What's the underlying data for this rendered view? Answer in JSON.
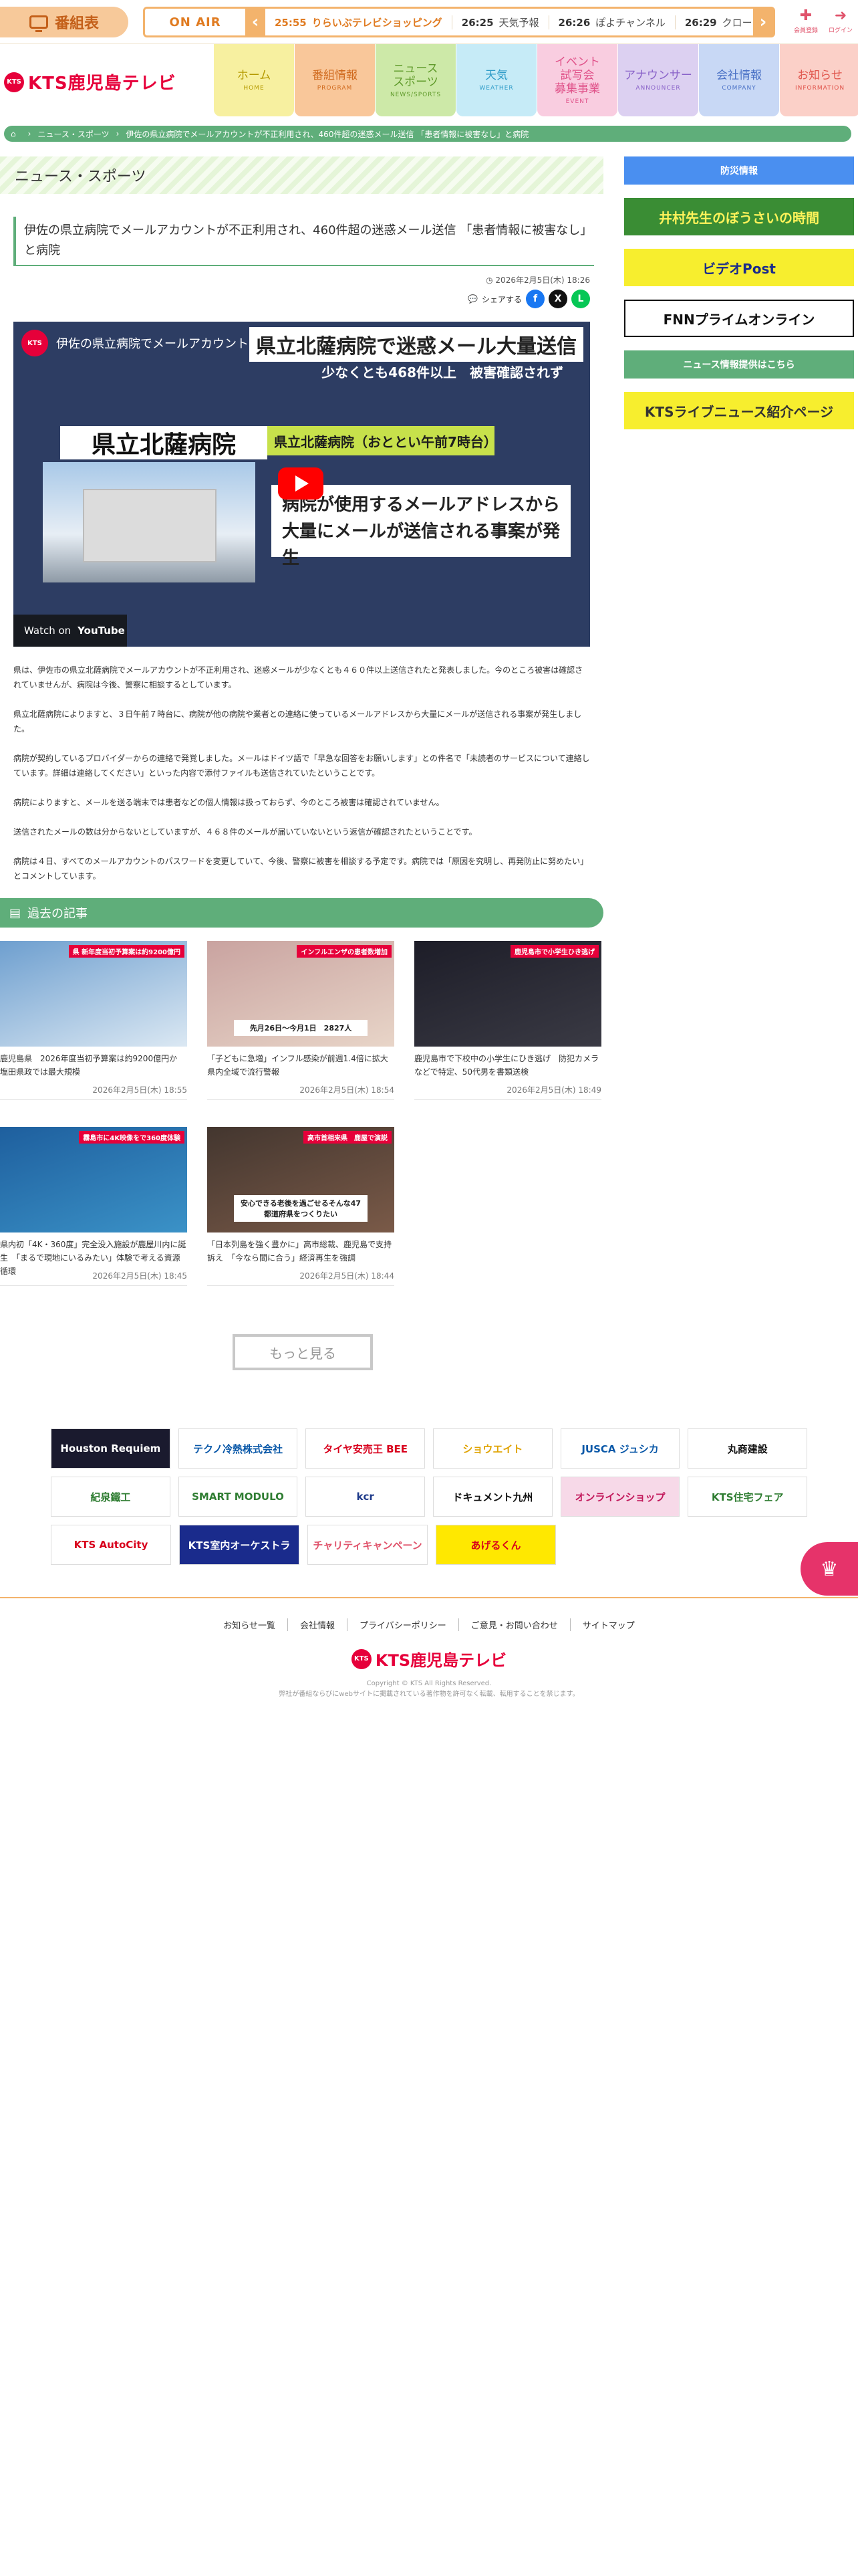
{
  "topbar": {
    "bangumi_label": "番組表",
    "onair_label": "ON AIR",
    "ticker": [
      {
        "time": "25:55",
        "title": "りらいぶテレビショッピング"
      },
      {
        "time": "26:25",
        "title": "天気予報"
      },
      {
        "time": "26:26",
        "title": "ぽよチャンネル"
      },
      {
        "time": "26:29",
        "title": "クロー"
      }
    ],
    "member_label": "会員登録",
    "login_label": "ログイン"
  },
  "logo": {
    "mark": "KTS",
    "text": "KTS鹿児島テレビ"
  },
  "nav": [
    {
      "jp": "ホーム",
      "en": "HOME",
      "bg": "#f7f0a0",
      "fg": "#b59a00"
    },
    {
      "jp": "番組情報",
      "en": "PROGRAM",
      "bg": "#f9c79a",
      "fg": "#d06a1e"
    },
    {
      "jp": "ニュース\nスポーツ",
      "en": "NEWS/SPORTS",
      "bg": "#cde9a8",
      "fg": "#5f9a2a"
    },
    {
      "jp": "天気",
      "en": "WEATHER",
      "bg": "#c6ebf7",
      "fg": "#2f9cc8"
    },
    {
      "jp": "イベント\n試写会\n募集事業",
      "en": "EVENT",
      "bg": "#f9cde0",
      "fg": "#e0538a"
    },
    {
      "jp": "アナウンサー",
      "en": "ANNOUNCER",
      "bg": "#dcd0f1",
      "fg": "#8a63c9"
    },
    {
      "jp": "会社情報",
      "en": "COMPANY",
      "bg": "#c8d8f5",
      "fg": "#4b72c6"
    },
    {
      "jp": "お知らせ",
      "en": "INFORMATION",
      "bg": "#fbd0c8",
      "fg": "#e0534a"
    }
  ],
  "breadcrumb": [
    "ニュース・スポーツ",
    "伊佐の県立病院でメールアカウントが不正利用され、460件超の迷惑メール送信 「患者情報に被害なし」と病院"
  ],
  "section_title": "ニュース・スポーツ",
  "article": {
    "title": "伊佐の県立病院でメールアカウントが不正利用され、460件超の迷惑メール送信 「患者情報に被害なし」と病院",
    "date": "2026年2月5日(木) 18:26",
    "share_label": "シェアする",
    "video": {
      "title": "伊佐の県立病院でメールアカウントが不正利用され、460件超の迷惑メール送信",
      "banner": "県立北薩病院で迷惑メール大量送信",
      "sub": "少なくとも468件以上　被害確認されず",
      "hospital": "県立北薩病院",
      "tag": "県立北薩病院（おととい午前7時台）",
      "caption": "病院が使用するメールアドレスから大量にメールが送信される事案が発生",
      "watch_on": "Watch on",
      "youtube": "YouTube"
    },
    "paragraphs": [
      "県は、伊佐市の県立北薩病院でメールアカウントが不正利用され、迷惑メールが少なくとも４６０件以上送信されたと発表しました。今のところ被害は確認されていませんが、病院は今後、警察に相談するとしています。",
      "県立北薩病院によりますと、３日午前７時台に、病院が他の病院や業者との連絡に使っているメールアドレスから大量にメールが送信される事案が発生しました。",
      "病院が契約しているプロバイダーからの連絡で発覚しました。メールはドイツ語で「早急な回答をお願いします」との件名で「未読者のサービスについて連絡しています。詳細は連絡してください」といった内容で添付ファイルも送信されていたということです。",
      "病院によりますと、メールを送る端末では患者などの個人情報は扱っておらず、今のところ被害は確認されていません。",
      "送信されたメールの数は分からないとしていますが、４６８件のメールが届いていないという返信が確認されたということです。",
      "病院は４日、すべてのメールアカウントのパスワードを変更していて、今後、警察に被害を相談する予定です。病院では「原因を究明し、再発防止に努めたい」とコメントしています。"
    ]
  },
  "past": {
    "header": "過去の記事",
    "items": [
      {
        "title": "鹿児島県　2026年度当初予算案は約9200億円か　塩田県政では最大規模",
        "date": "2026年2月5日(木) 18:55"
      },
      {
        "title": "「子どもに急増」インフル感染が前週1.4倍に拡大　県内全域で流行警報",
        "date": "2026年2月5日(木) 18:54"
      },
      {
        "title": "鹿児島市で下校中の小学生にひき逃げ　防犯カメラなどで特定、50代男を書類送検",
        "date": "2026年2月5日(木) 18:49"
      },
      {
        "title": "県内初「4K・360度」完全没入施設が鹿屋川内に誕生　「まるで現地にいるみたい」体験で考える資源循環",
        "date": "2026年2月5日(木) 18:45"
      },
      {
        "title": "「日本列島を強く豊かに」高市総裁、鹿児島で支持訴え　「今なら間に合う」経済再生を強調",
        "date": "2026年2月5日(木) 18:44"
      }
    ],
    "thumbs": [
      {
        "caption": "県 新年度当初予算案は約9200億円",
        "bg1": "#6e9fcf",
        "bg2": "#dbe8f3"
      },
      {
        "caption": "インフルエンザの患者数増加",
        "bg1": "#c9a3a0",
        "bg2": "#e8d5c8",
        "box": "先月26日～今月1日　2827人"
      },
      {
        "caption": "鹿児島市で小学生ひき逃げ",
        "bg1": "#1d1d28",
        "bg2": "#3a3a44"
      },
      {
        "caption": "霧島市に4K映像をで360度体験",
        "bg1": "#1e5f9e",
        "bg2": "#3b92c7"
      },
      {
        "caption": "高市首相来県　鹿屋で演説",
        "bg1": "#43362f",
        "bg2": "#7a5a48",
        "box": "安心できる老後を過ごせるそんな47都道府県をつくりたい"
      }
    ],
    "more_label": "もっと見る"
  },
  "sidebar": [
    {
      "label": "防災情報",
      "bg": "#4a8ff0",
      "fg": "#ffffff",
      "h": 42
    },
    {
      "label": "井村先生のぼうさいの時間",
      "bg": "#3a8d34",
      "fg": "#fff35a",
      "h": 56
    },
    {
      "label": "ビデオPost",
      "bg": "#f7ee2e",
      "fg": "#1a2b8c",
      "h": 56
    },
    {
      "label": "FNNプライムオンライン",
      "bg": "#ffffff",
      "fg": "#111111",
      "h": 56
    },
    {
      "label": "ニュース情報提供はこちら",
      "bg": "#5fae7a",
      "fg": "#ffffff",
      "h": 42
    },
    {
      "label": "KTSライブニュース紹介ページ",
      "bg": "#f7ee2e",
      "fg": "#333333",
      "h": 56
    }
  ],
  "sponsors": [
    [
      "Houston Requiem",
      "テクノ冷熱株式会社",
      "タイヤ安売王 BEE",
      "ショウエイト",
      "JUSCA ジュシカ",
      "丸商建設"
    ],
    [
      "紀泉鐵工",
      "SMART MODULO",
      "kcr",
      "ドキュメント九州",
      "オンラインショップ",
      "KTS住宅フェア"
    ],
    [
      "KTS AutoCity",
      "KTS室内オーケストラ",
      "チャリティキャンペーン",
      "あげるくん"
    ]
  ],
  "footer": {
    "links": [
      "お知らせ一覧",
      "会社情報",
      "プライバシーポリシー",
      "ご意見・お問い合わせ",
      "サイトマップ"
    ],
    "logo": "KTS鹿児島テレビ",
    "copyright": "Copyright © KTS All Rights Reserved.",
    "note": "弊社が番組ならびにwebサイトに掲載されている著作物を許可なく転載、転用することを禁じます。"
  }
}
